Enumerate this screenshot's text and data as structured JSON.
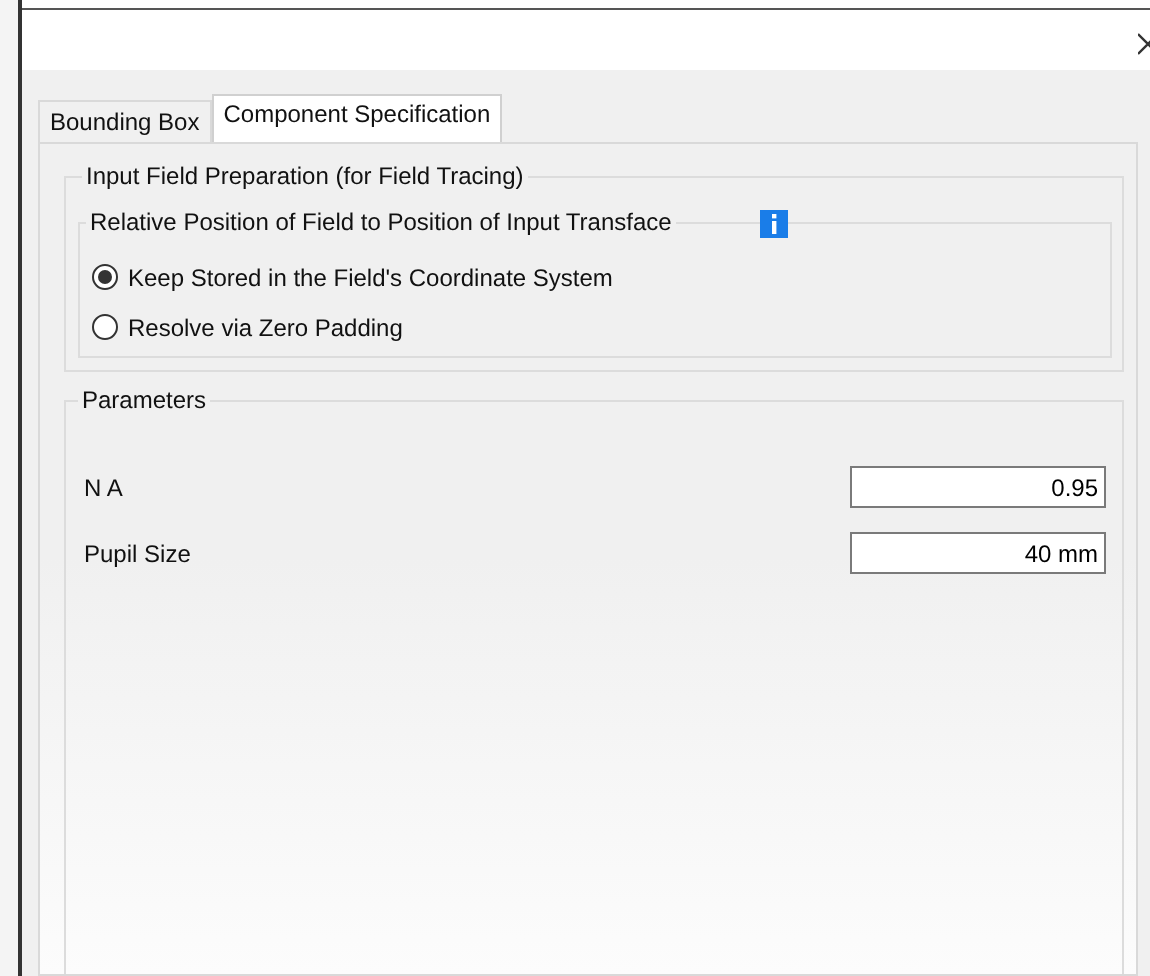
{
  "tabs": [
    {
      "label": "Bounding Box",
      "selected": false
    },
    {
      "label": "Component Specification",
      "selected": true
    }
  ],
  "preparation": {
    "title": "Input Field Preparation (for Field Tracing)",
    "position": {
      "title": "Relative Position of Field to Position of Input Transface",
      "options": [
        {
          "label": "Keep Stored in the Field's Coordinate System",
          "selected": true
        },
        {
          "label": "Resolve via Zero Padding",
          "selected": false
        }
      ]
    }
  },
  "parameters": {
    "title": "Parameters",
    "fields": [
      {
        "label": "N A",
        "value": "0.95"
      },
      {
        "label": "Pupil Size",
        "value": "40 mm"
      }
    ]
  }
}
